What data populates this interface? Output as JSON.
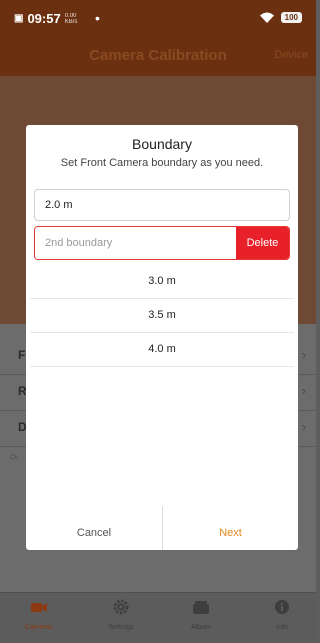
{
  "status_bar": {
    "time": "09:57",
    "net_speed_top": "0.00",
    "net_speed_bottom": "KB/s",
    "dot": "•",
    "battery": "100"
  },
  "header": {
    "title": "Camera Calibration",
    "device_label": "Device"
  },
  "background_list": {
    "rows": [
      {
        "letter": "F"
      },
      {
        "letter": "R"
      },
      {
        "letter": "D"
      }
    ],
    "chevron": "›",
    "note": "Ch"
  },
  "dialog": {
    "title": "Boundary",
    "subtitle": "Set Front Camera boundary as you need.",
    "first_boundary_value": "2.0 m",
    "second_boundary_placeholder": "2nd boundary",
    "delete_label": "Delete",
    "options": [
      "3.0 m",
      "3.5 m",
      "4.0 m"
    ],
    "cancel_label": "Cancel",
    "next_label": "Next"
  },
  "bottom_nav": {
    "items": [
      {
        "label": "Cameras",
        "icon": "camera-icon",
        "active": true
      },
      {
        "label": "Settings",
        "icon": "gear-icon",
        "active": false
      },
      {
        "label": "Album",
        "icon": "album-icon",
        "active": false
      },
      {
        "label": "Info",
        "icon": "info-icon",
        "active": false
      }
    ]
  },
  "colors": {
    "brand": "#6b3010",
    "delete": "#e8202a",
    "accent_next": "#e08a1e",
    "active_tab": "#8b3a12"
  }
}
